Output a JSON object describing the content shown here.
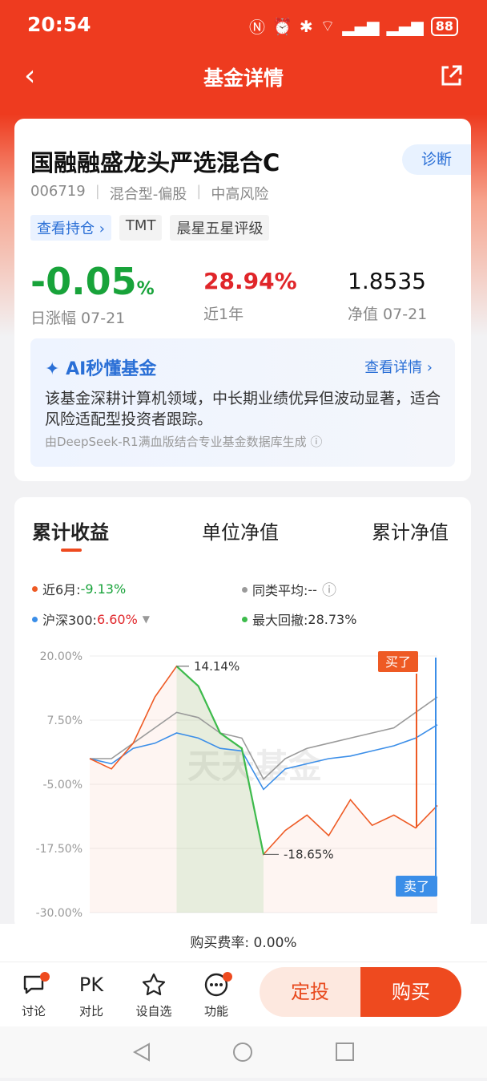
{
  "status_bar": {
    "time": "20:54",
    "battery": "88"
  },
  "nav": {
    "title": "基金详情"
  },
  "fund": {
    "name": "国融融盛龙头严选混合C",
    "diagnose_label": "诊断",
    "code": "006719",
    "type": "混合型-偏股",
    "risk": "中高风险",
    "tags": [
      "查看持仓 ›",
      "TMT",
      "晨星五星评级"
    ],
    "daily_change": "-0.05",
    "daily_change_unit": "%",
    "daily_change_label": "日涨幅 07-21",
    "year_return": "28.94%",
    "year_return_label": "近1年",
    "nav_value": "1.8535",
    "nav_label": "净值 07-21"
  },
  "ai": {
    "title": "AI秒懂基金",
    "more": "查看详情 ›",
    "text": "该基金深耕计算机领域，中长期业绩优异但波动显著，适合风险适配型投资者跟踪。",
    "source": "由DeepSeek-R1满血版结合专业基金数据库生成 ⓘ"
  },
  "chart_tabs": [
    "累计收益",
    "单位净值",
    "累计净值"
  ],
  "legend": {
    "fund_label": "近6月:",
    "fund_value": "-9.13%",
    "avg_label": "同类平均:",
    "avg_value": "--",
    "index_label": "沪深300:",
    "index_value": "6.60%",
    "dd_label": "最大回撤:",
    "dd_value": "28.73%"
  },
  "colors": {
    "fund": "#ee5a24",
    "avg": "#9a9a9a",
    "index": "#3b8ee8",
    "drawdown": "#3dbb4c"
  },
  "chart_data": {
    "type": "line",
    "yticks": [
      "20.00%",
      "7.50%",
      "-5.00%",
      "-17.50%",
      "-30.00%"
    ],
    "ylim": [
      -30,
      20
    ],
    "x_range": [
      "2025-01-21",
      "2025-07-21"
    ],
    "series": [
      {
        "name": "近6月",
        "values": [
          0.0,
          -2.0,
          3.0,
          12.0,
          18.0,
          14.14,
          5.0,
          2.0,
          -18.65,
          -14.0,
          -11.0,
          -15.0,
          -8.0,
          -13.0,
          -11.0,
          -13.5,
          -9.13
        ]
      },
      {
        "name": "沪深300",
        "values": [
          0.0,
          -1.0,
          2.0,
          3.0,
          5.0,
          4.0,
          2.0,
          1.5,
          -6.0,
          -2.0,
          -1.0,
          0.0,
          0.5,
          1.5,
          2.5,
          4.0,
          6.6
        ]
      },
      {
        "name": "同类平均",
        "values": [
          0.0,
          0.0,
          3.0,
          6.0,
          9.0,
          8.0,
          5.0,
          4.0,
          -4.0,
          0.0,
          2.0,
          3.0,
          4.0,
          5.0,
          6.0,
          9.0,
          12.0
        ]
      }
    ],
    "annotations": {
      "max": "14.14%",
      "min": "-18.65%",
      "buy": "买了",
      "sell": "卖了"
    },
    "watermark": "天天基金"
  },
  "fee": "购买费率: 0.00%",
  "bottom_bar": {
    "items": [
      "讨论",
      "对比",
      "设自选",
      "功能"
    ],
    "pk": "PK",
    "dingtou": "定投",
    "buy": "购买"
  }
}
